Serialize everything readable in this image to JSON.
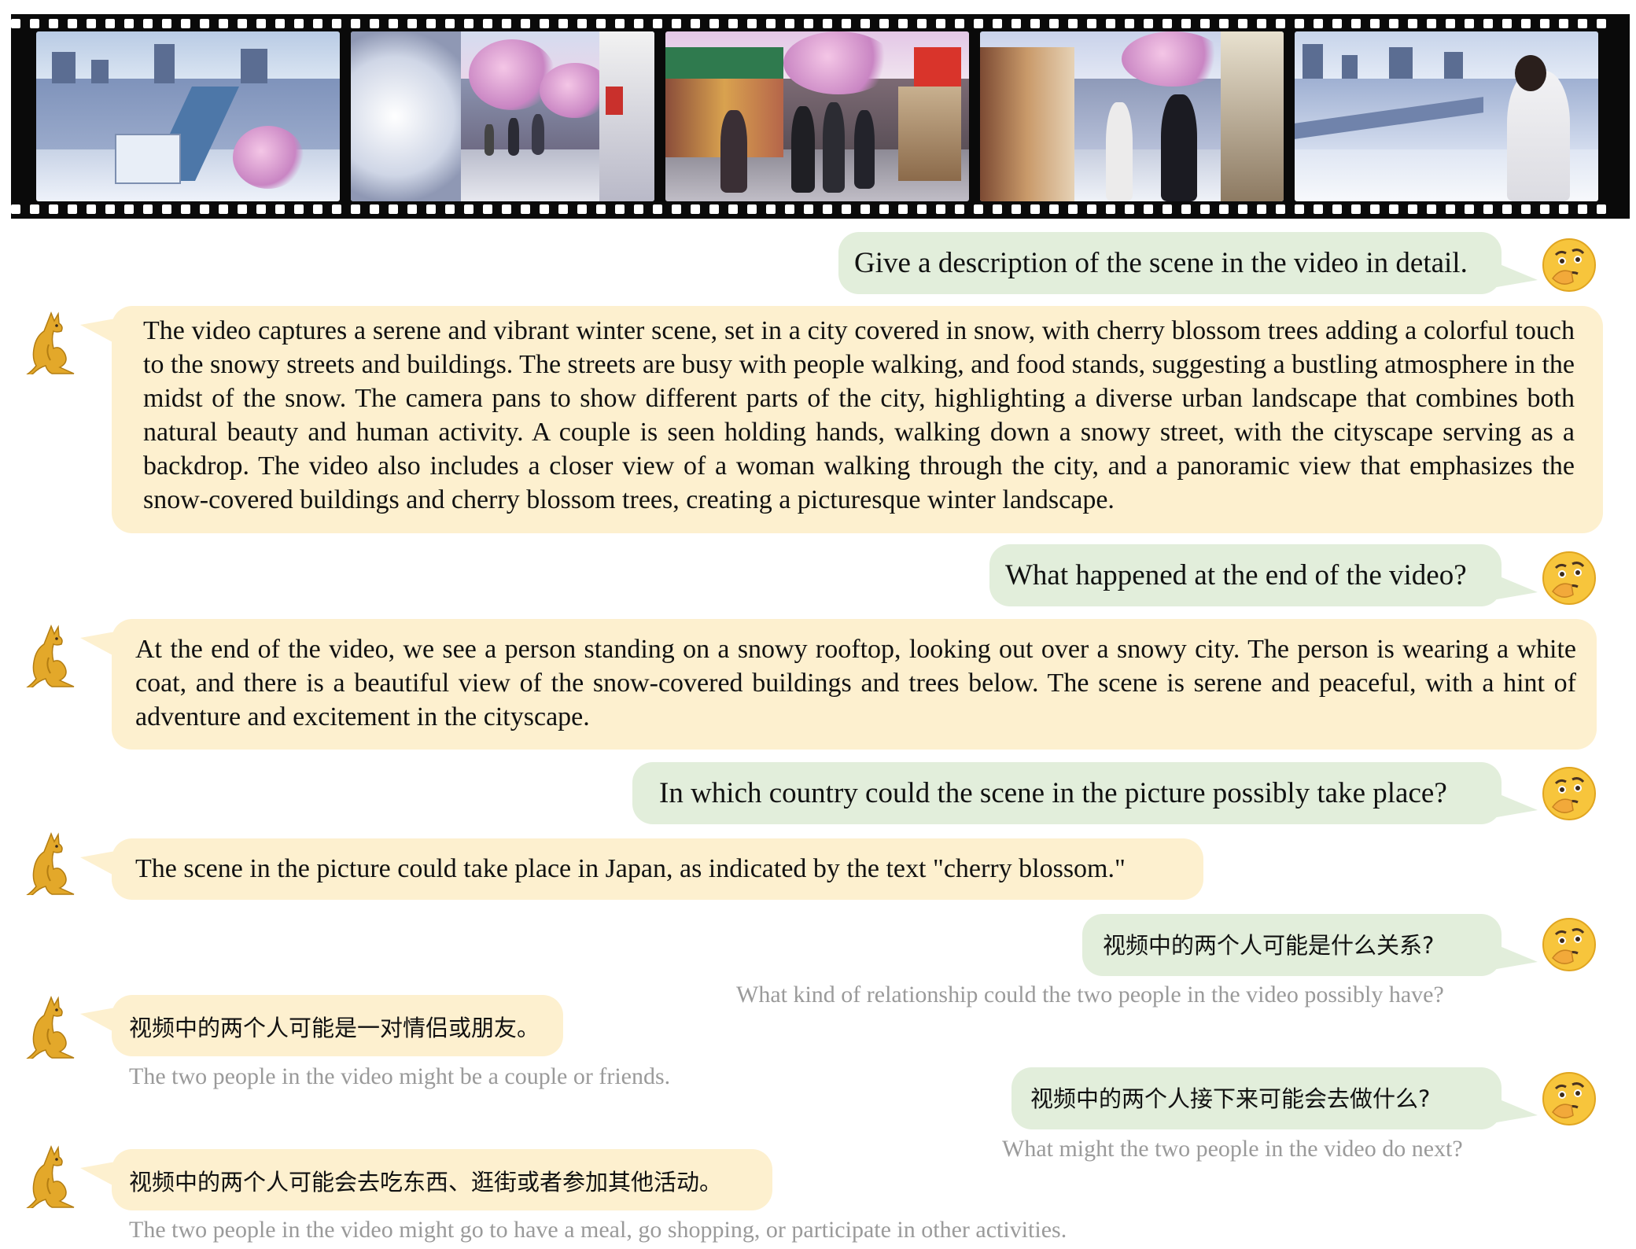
{
  "messages": {
    "q1": "Give a description of the scene in the video in detail.",
    "a1": "The video captures a serene and vibrant winter scene, set in a city covered in snow, with cherry blossom trees adding a colorful touch to the snowy streets and buildings. The streets are busy with people walking, and food stands, suggesting a bustling atmosphere in the midst of the snow. The camera pans to show different parts of the city, highlighting a diverse urban landscape that combines both natural beauty and human activity. A couple is seen holding hands, walking down a snowy street, with the cityscape serving as a backdrop. The video also includes a closer view of a woman walking through the city, and a panoramic view that emphasizes the snow-covered buildings and cherry blossom trees, creating a picturesque winter landscape.",
    "q2": "What happened at the end of the video?",
    "a2": "At the end of the video, we see a person standing on a snowy rooftop, looking out over a snowy city. The person is wearing a white coat, and there is a beautiful view of the snow-covered buildings and trees below. The scene is serene and peaceful, with a hint of adventure and excitement in the cityscape.",
    "q3": "In which country could the scene in the picture possibly take place?",
    "a3": "The scene in the picture could take place in Japan, as indicated by the text \"cherry blossom.\"",
    "q4": "视频中的两个人可能是什么关系?",
    "q4_translation": "What kind of relationship could the two people in the video possibly have?",
    "a4": "视频中的两个人可能是一对情侣或朋友。",
    "a4_translation": "The two people in the video might be a couple or friends.",
    "q5": "视频中的两个人接下来可能会去做什么?",
    "q5_translation": "What might the two people in the video do next?",
    "a5": "视频中的两个人可能会去吃东西、逛街或者参加其他活动。",
    "a5_translation": "The two people in the video might go to have a meal, go shopping, or participate in other activities."
  },
  "icons": {
    "user": "thinking-face-emoji",
    "assistant": "kangaroo-emoji"
  },
  "colors": {
    "question_bubble": "#e2eedb",
    "answer_bubble": "#fdf0cf",
    "translation_text": "#9a9a9a",
    "film": "#0a0a0a"
  }
}
